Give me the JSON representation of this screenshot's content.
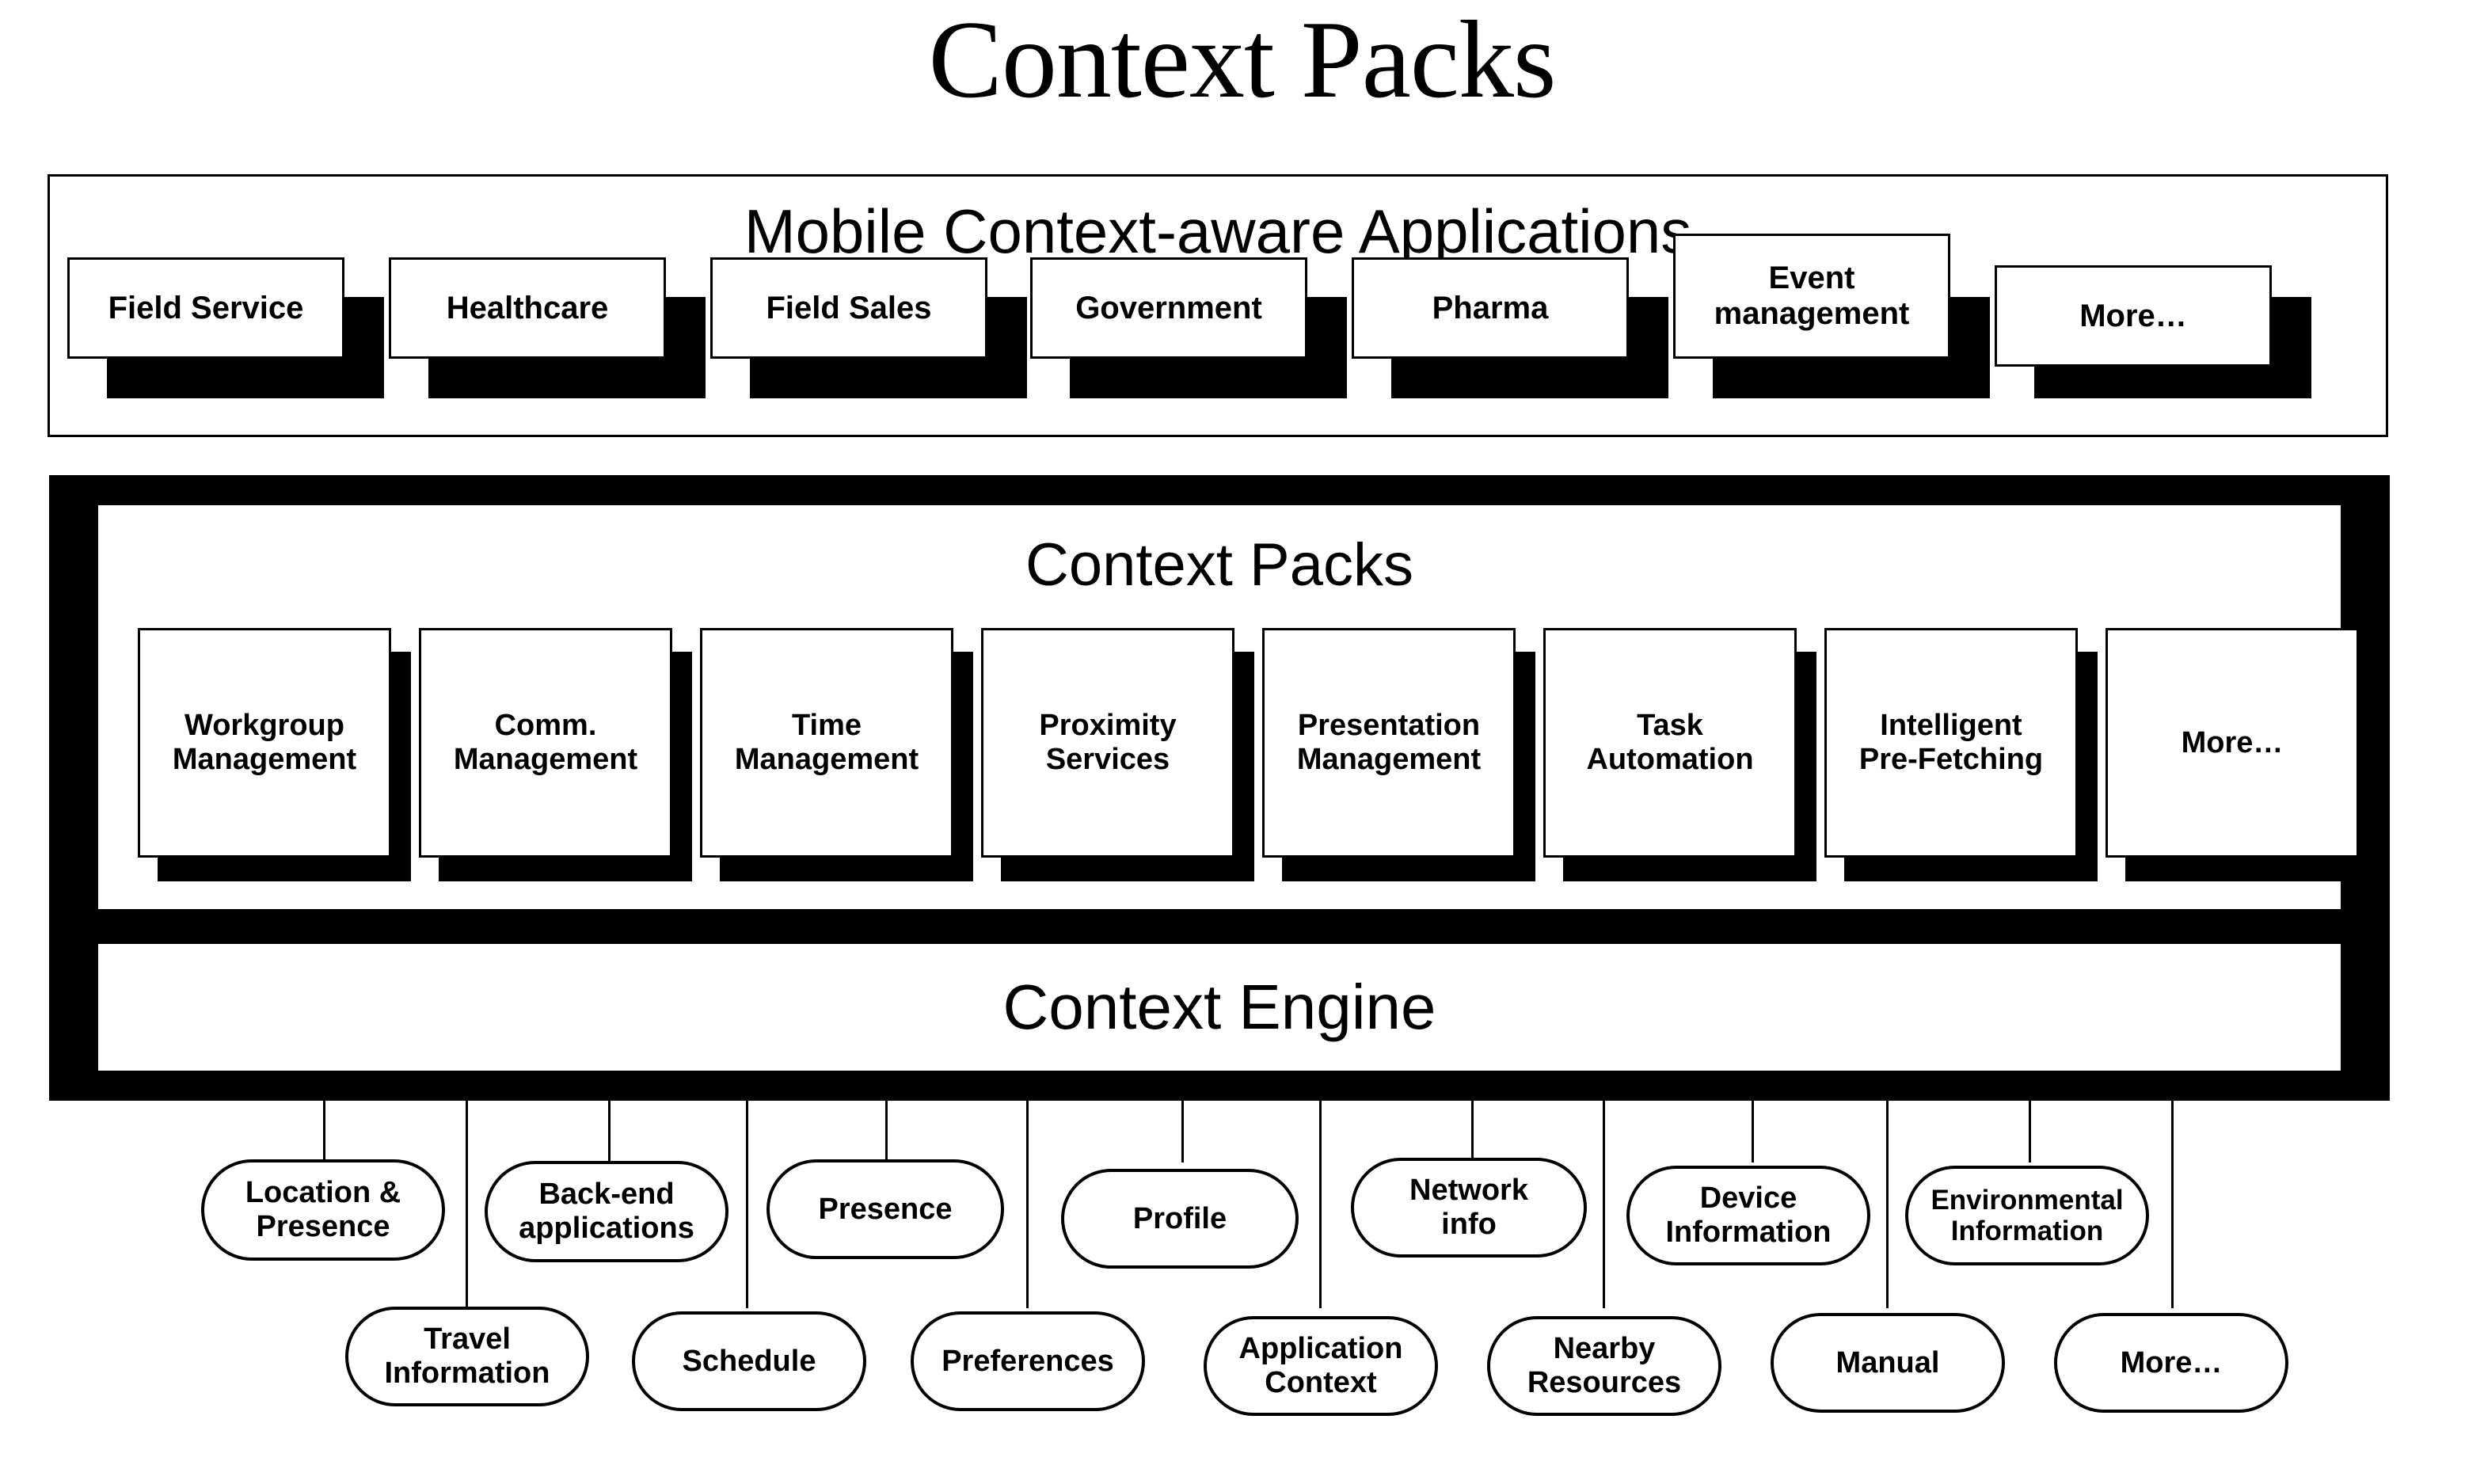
{
  "title": "Context Packs",
  "applications_panel": {
    "heading": "Mobile Context-aware Applications",
    "items": [
      {
        "label": "Field Service"
      },
      {
        "label": "Healthcare"
      },
      {
        "label": "Field Sales"
      },
      {
        "label": "Government"
      },
      {
        "label": "Pharma"
      },
      {
        "label": "Event\nmanagement"
      },
      {
        "label": "More…"
      }
    ]
  },
  "packs_panel": {
    "heading": "Context Packs",
    "items": [
      {
        "label": "Workgroup\nManagement"
      },
      {
        "label": "Comm.\nManagement"
      },
      {
        "label": "Time\nManagement"
      },
      {
        "label": "Proximity\nServices"
      },
      {
        "label": "Presentation\nManagement"
      },
      {
        "label": "Task\nAutomation"
      },
      {
        "label": "Intelligent\nPre-Fetching"
      },
      {
        "label": "More…"
      }
    ]
  },
  "engine_panel": {
    "heading": "Context Engine"
  },
  "context_sources": {
    "top_row": [
      {
        "label": "Location &\nPresence"
      },
      {
        "label": "Back-end\napplications"
      },
      {
        "label": "Presence"
      },
      {
        "label": "Profile"
      },
      {
        "label": "Network\ninfo"
      },
      {
        "label": "Device\nInformation"
      },
      {
        "label": "Environmental\nInformation"
      }
    ],
    "bottom_row": [
      {
        "label": "Travel\nInformation"
      },
      {
        "label": "Schedule"
      },
      {
        "label": "Preferences"
      },
      {
        "label": "Application\nContext"
      },
      {
        "label": "Nearby\nResources"
      },
      {
        "label": "Manual"
      },
      {
        "label": "More…"
      }
    ]
  },
  "colors": {
    "ink": "#000000",
    "paper": "#ffffff"
  }
}
